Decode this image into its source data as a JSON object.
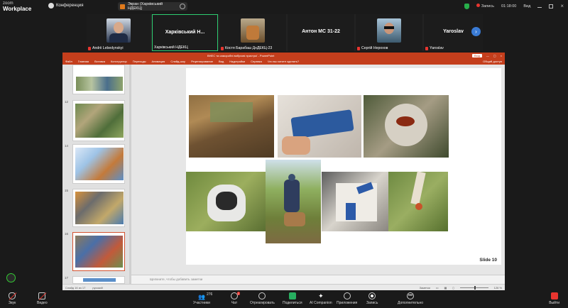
{
  "app": {
    "logo_top": "zoom",
    "logo_bottom": "Workplace",
    "conference_label": "Конференция"
  },
  "share": {
    "label": "Экран (Харківський НДЕКЦ)"
  },
  "status": {
    "recording": "Запись",
    "time": "01:18:00",
    "view": "Вид"
  },
  "participants": [
    {
      "name": "Andrii Lebedynskyi",
      "big": "",
      "has_video": true,
      "muted": true
    },
    {
      "name": "Харківський НДЕКЦ",
      "big": "Харківський Н...",
      "has_video": false,
      "muted": false,
      "active": true
    },
    {
      "name": "Костя Барабаш ДнДЕКЦ-23",
      "big": "",
      "has_video": true,
      "muted": true
    },
    {
      "name": "Антон МС 31-22",
      "big": "Антон МС 31-22",
      "has_video": false,
      "muted": false
    },
    {
      "name": "Сергій Нерохов",
      "big": "",
      "has_video": true,
      "muted": true
    },
    {
      "name": "Yaroslav",
      "big": "Yaroslav",
      "has_video": false,
      "muted": true
    }
  ],
  "ppt": {
    "title": "ВНЕС та саморобні вибухові пристрої  -  PowerPoint",
    "sign_in": "Вхід",
    "menu": [
      "Файл",
      "Главная",
      "Вставка",
      "Конструктор",
      "Переходы",
      "Анимация",
      "Слайд-шоу",
      "Рецензирование",
      "Вид",
      "Надстройки",
      "Справка",
      "Что вы хотите сделать?"
    ],
    "share_btn": "Общий доступ",
    "thumb_numbers": [
      "12",
      "14",
      "15",
      "16",
      "17"
    ],
    "slide_label": "Slide 10",
    "notes_placeholder": "Щелкните, чтобы добавить заметки",
    "status_left": "Слайд 16 из 17",
    "language": "русский",
    "notes_btn": "Заметки",
    "zoom": "126 %"
  },
  "toolbar": [
    {
      "label": "Звук",
      "name": "audio-button"
    },
    {
      "label": "Видео",
      "name": "video-button"
    },
    {
      "label": "Участники",
      "name": "participants-button",
      "count": "276"
    },
    {
      "label": "Чат",
      "name": "chat-button",
      "badge": "1"
    },
    {
      "label": "Отреагировать",
      "name": "react-button"
    },
    {
      "label": "Поделиться",
      "name": "share-button"
    },
    {
      "label": "AI Companion",
      "name": "ai-companion-button"
    },
    {
      "label": "Приложения",
      "name": "apps-button"
    },
    {
      "label": "Запись",
      "name": "record-button"
    },
    {
      "label": "Дополнительно",
      "name": "more-button"
    }
  ],
  "leave": "Выйти"
}
